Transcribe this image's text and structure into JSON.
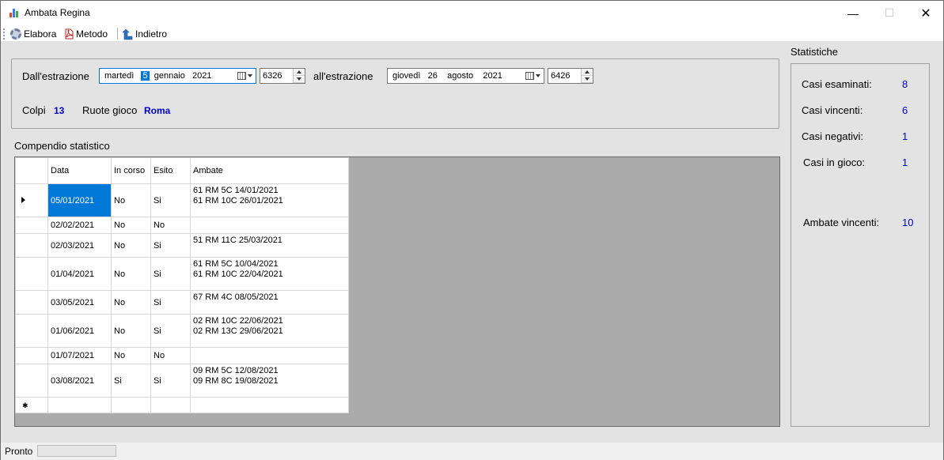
{
  "window": {
    "title": "Ambata Regina"
  },
  "toolbar": {
    "elabora": "Elabora",
    "metodo": "Metodo",
    "indietro": "Indietro"
  },
  "filter": {
    "dall_label": "Dall'estrazione",
    "from_date": {
      "weekday": "martedì",
      "day": "5",
      "month": "gennaio",
      "year": "2021"
    },
    "from_number": "6326",
    "all_label": "all'estrazione",
    "to_date": {
      "weekday": "giovedì",
      "day": "26",
      "month": "agosto",
      "year": "2021"
    },
    "to_number": "6426",
    "colpi_label": "Colpi",
    "colpi_value": "13",
    "ruote_label": "Ruote gioco",
    "ruote_value": "Roma"
  },
  "compendio": {
    "title": "Compendio statistico",
    "columns": [
      "Data",
      "In corso",
      "Esito",
      "Ambate"
    ],
    "rows": [
      {
        "data": "05/01/2021",
        "corso": "No",
        "esito": "Si",
        "ambate": [
          "61 RM 5C 14/01/2021",
          "61 RM 10C 26/01/2021"
        ]
      },
      {
        "data": "02/02/2021",
        "corso": "No",
        "esito": "No",
        "ambate": []
      },
      {
        "data": "02/03/2021",
        "corso": "No",
        "esito": "Si",
        "ambate": [
          "51 RM 11C 25/03/2021"
        ]
      },
      {
        "data": "01/04/2021",
        "corso": "No",
        "esito": "Si",
        "ambate": [
          "61 RM 5C 10/04/2021",
          "61 RM 10C 22/04/2021"
        ]
      },
      {
        "data": "03/05/2021",
        "corso": "No",
        "esito": "Si",
        "ambate": [
          "67 RM 4C 08/05/2021"
        ]
      },
      {
        "data": "01/06/2021",
        "corso": "No",
        "esito": "Si",
        "ambate": [
          "02 RM 10C 22/06/2021",
          "02 RM 13C 29/06/2021"
        ]
      },
      {
        "data": "01/07/2021",
        "corso": "No",
        "esito": "No",
        "ambate": []
      },
      {
        "data": "03/08/2021",
        "corso": "Si",
        "esito": "Si",
        "ambate": [
          "09 RM 5C 12/08/2021",
          "09 RM 8C 19/08/2021"
        ]
      }
    ]
  },
  "stats": {
    "title": "Statistiche",
    "casi_esaminati_label": "Casi esaminati:",
    "casi_esaminati": "8",
    "casi_vincenti_label": "Casi vincenti:",
    "casi_vincenti": "6",
    "casi_negativi_label": "Casi negativi:",
    "casi_negativi": "1",
    "casi_gioco_label": "Casi in gioco:",
    "casi_gioco": "1",
    "ambate_vincenti_label": "Ambate vincenti:",
    "ambate_vincenti": "10"
  },
  "status": {
    "text": "Pronto"
  }
}
